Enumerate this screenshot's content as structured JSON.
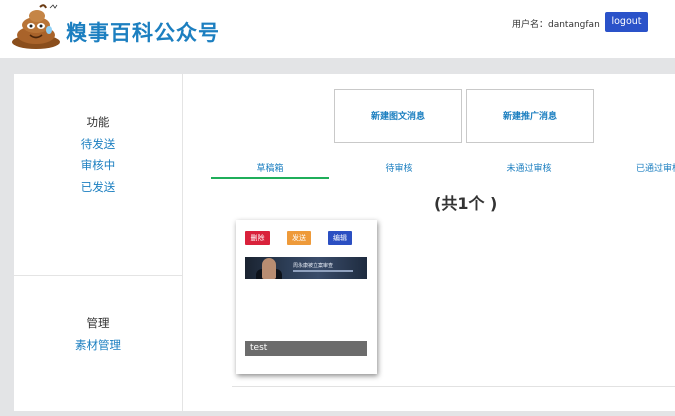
{
  "header": {
    "brand": "糗事百科公众号",
    "user_label": "用户名：dantangfan",
    "logout_label": "logout"
  },
  "sidebar": {
    "sections": [
      {
        "heading": "功能",
        "items": [
          "待发送",
          "审核中",
          "已发送"
        ]
      },
      {
        "heading": "管理",
        "items": [
          "素材管理"
        ]
      }
    ]
  },
  "actions": {
    "new_article": "新建图文消息",
    "new_promo": "新建推广消息"
  },
  "tabs": [
    {
      "label": "草稿箱",
      "active": true
    },
    {
      "label": "待审核",
      "active": false
    },
    {
      "label": "未通过审核",
      "active": false
    },
    {
      "label": "已通过审核",
      "active": false
    }
  ],
  "count_text": "(共1个 )",
  "card": {
    "buttons": {
      "delete": "删除",
      "send": "发送",
      "edit": "编辑"
    },
    "thumbnail_caption": "周永康被立案审查",
    "title": "test"
  },
  "colors": {
    "accent": "#1c7fc0",
    "logout_bg": "#2a52c9",
    "tab_underline": "#1fae5a",
    "delete_btn": "#d9213b",
    "send_btn": "#ee9a3a",
    "edit_btn": "#2b4fc2"
  }
}
